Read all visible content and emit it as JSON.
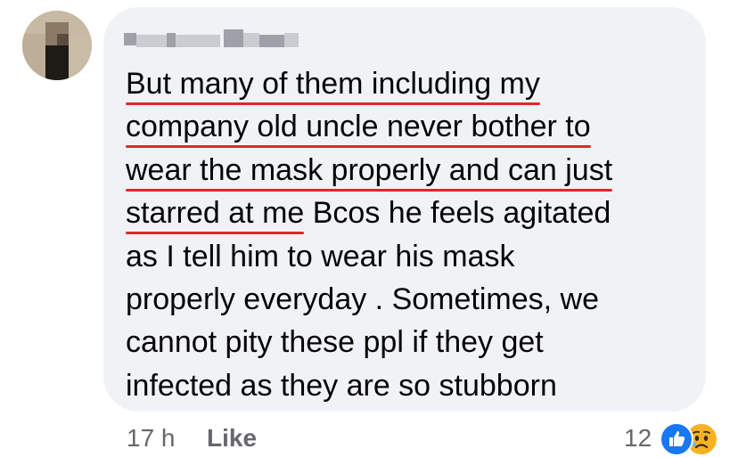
{
  "comment": {
    "lines": [
      {
        "segments": [
          {
            "text": "But many of them including my",
            "flag": true
          }
        ]
      },
      {
        "segments": [
          {
            "text": "company old uncle never bother to",
            "flag": true
          }
        ]
      },
      {
        "segments": [
          {
            "text": "wear the mask properly and can just",
            "flag": true
          }
        ]
      },
      {
        "segments": [
          {
            "text": "starred at me",
            "flag": true
          },
          {
            "text": " Bcos he feels agitated",
            "flag": false
          }
        ]
      },
      {
        "segments": [
          {
            "text": "as I tell  him to wear his mask",
            "flag": false
          }
        ]
      },
      {
        "segments": [
          {
            "text": "properly everyday .  Sometimes, we",
            "flag": false
          }
        ]
      },
      {
        "segments": [
          {
            "text": "cannot pity these ppl if they get",
            "flag": false
          }
        ]
      },
      {
        "segments": [
          {
            "text": "infected as they are so stubborn",
            "flag": false
          }
        ]
      }
    ]
  },
  "footer": {
    "time": "17 h",
    "like_label": "Like",
    "reaction_count": "12",
    "reactions": [
      "like-icon",
      "sad-face-icon"
    ]
  },
  "colors": {
    "bubble": "#f0f2f5",
    "text": "#050505",
    "meta": "#65676b",
    "spellcheck": "#e3262c",
    "like_blue": "#1877f2",
    "sad_yellow": "#f7b125"
  }
}
